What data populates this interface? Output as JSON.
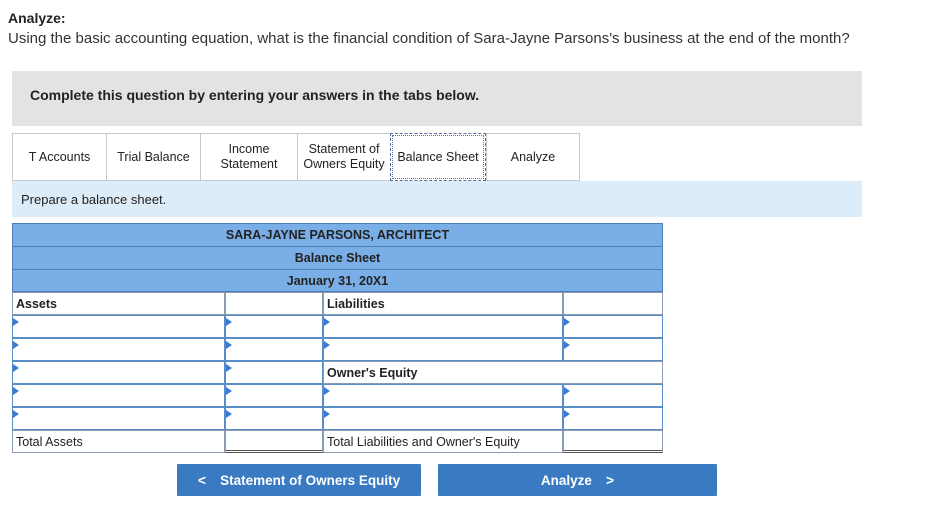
{
  "question": {
    "heading": "Analyze:",
    "text": "Using the basic accounting equation, what is the financial condition of Sara-Jayne Parsons's business at the end of the month?"
  },
  "instruction": "Complete this question by entering your answers in the tabs below.",
  "tabs": [
    {
      "label_line1": "T Accounts",
      "label_line2": ""
    },
    {
      "label_line1": "Trial Balance",
      "label_line2": ""
    },
    {
      "label_line1": "Income",
      "label_line2": "Statement"
    },
    {
      "label_line1": "Statement of",
      "label_line2": "Owners Equity"
    },
    {
      "label_line1": "Balance Sheet",
      "label_line2": ""
    },
    {
      "label_line1": "Analyze",
      "label_line2": ""
    }
  ],
  "prompt": "Prepare a balance sheet.",
  "sheet": {
    "company": "SARA-JAYNE PARSONS, ARCHITECT",
    "statement": "Balance Sheet",
    "date": "January 31, 20X1",
    "assets_label": "Assets",
    "liabilities_label": "Liabilities",
    "owners_equity_label": "Owner's Equity",
    "total_assets_label": "Total Assets",
    "total_liabilities_equity_label": "Total Liabilities and Owner's Equity"
  },
  "nav": {
    "prev_label": "Statement of Owners Equity",
    "prev_icon": "chevron-left-icon",
    "next_label": "Analyze",
    "next_icon": "chevron-right-icon"
  },
  "colors": {
    "header_blue": "#7aaee6",
    "button_blue": "#3a7ac3",
    "prompt_bg": "#dcecf9",
    "instruction_bg": "#e3e3e3"
  }
}
